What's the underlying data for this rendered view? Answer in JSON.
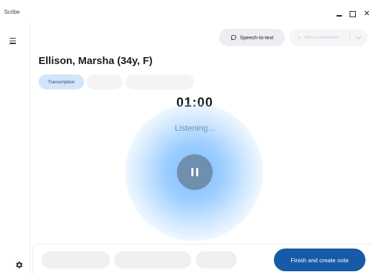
{
  "app": {
    "title": "Scribe"
  },
  "window_controls": {
    "minimize_icon": "minimize-icon",
    "maximize_icon": "maximize-icon",
    "close_icon": "close-icon"
  },
  "sidebar": {
    "menu_icon": "hamburger-menu-icon",
    "settings_icon": "gear-icon"
  },
  "header": {
    "speech_button_label": "Speech-to-text",
    "speech_icon": "chat-bubble-icon",
    "new_consultation_label": "New consultation",
    "new_consultation_disabled": true
  },
  "patient": {
    "name": "Ellison, Marsha (34y, F)"
  },
  "tabs": [
    {
      "label": "Transcription",
      "active": true
    }
  ],
  "recording": {
    "timer": "01:00",
    "status": "Listening..."
  },
  "footer": {
    "finish_label": "Finish and create note"
  },
  "colors": {
    "accent": "#175aa7",
    "tab_active_bg": "#d3e5fb",
    "pause_button": "#6f8fae",
    "glow": "#8cc6ff"
  }
}
